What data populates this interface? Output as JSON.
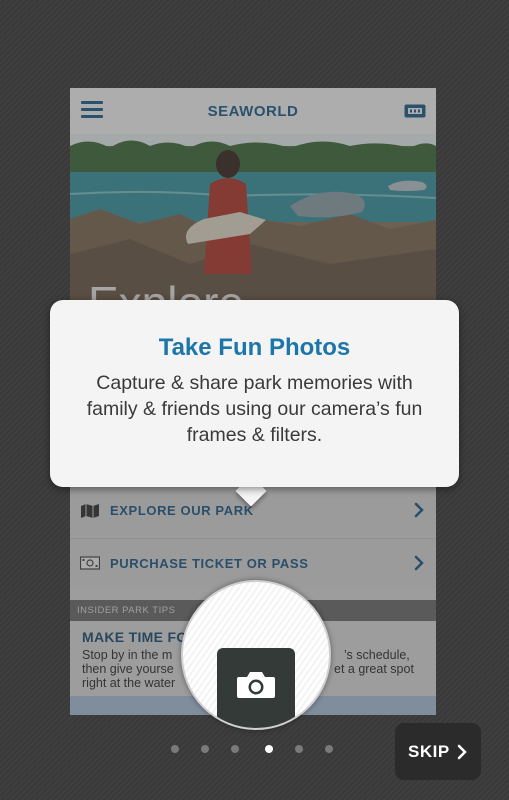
{
  "app": {
    "title": "SEAWORLD"
  },
  "hero": {
    "word": "Explore"
  },
  "icons": {
    "menu": "hamburger-menu-icon",
    "ticket": "ticket-icon",
    "map": "map-icon",
    "money": "money-icon",
    "chevron": "chevron-right-icon",
    "camera": "camera-icon"
  },
  "menu_rows": [
    {
      "label": "EXPLORE OUR PARK"
    },
    {
      "label": "PURCHASE TICKET OR PASS"
    }
  ],
  "tips": {
    "section_title": "INSIDER PARK TIPS",
    "title": "MAKE TIME FO",
    "body_line1": "Stop by in the m",
    "body_line1_end": "’s schedule,",
    "body_line2": "then give yourse",
    "body_line2_end": "et a great spot",
    "body_line3": "right at the water"
  },
  "popup": {
    "title": "Take Fun Photos",
    "body": "Capture & share park memories with family & friends using our camera’s fun frames & filters."
  },
  "pagination": {
    "total": 6,
    "active_index": 3
  },
  "skip": {
    "label": "SKIP"
  },
  "colors": {
    "brand_blue": "#1f5f8a",
    "popup_title": "#1d76aa",
    "background": "#3c3c3c"
  }
}
